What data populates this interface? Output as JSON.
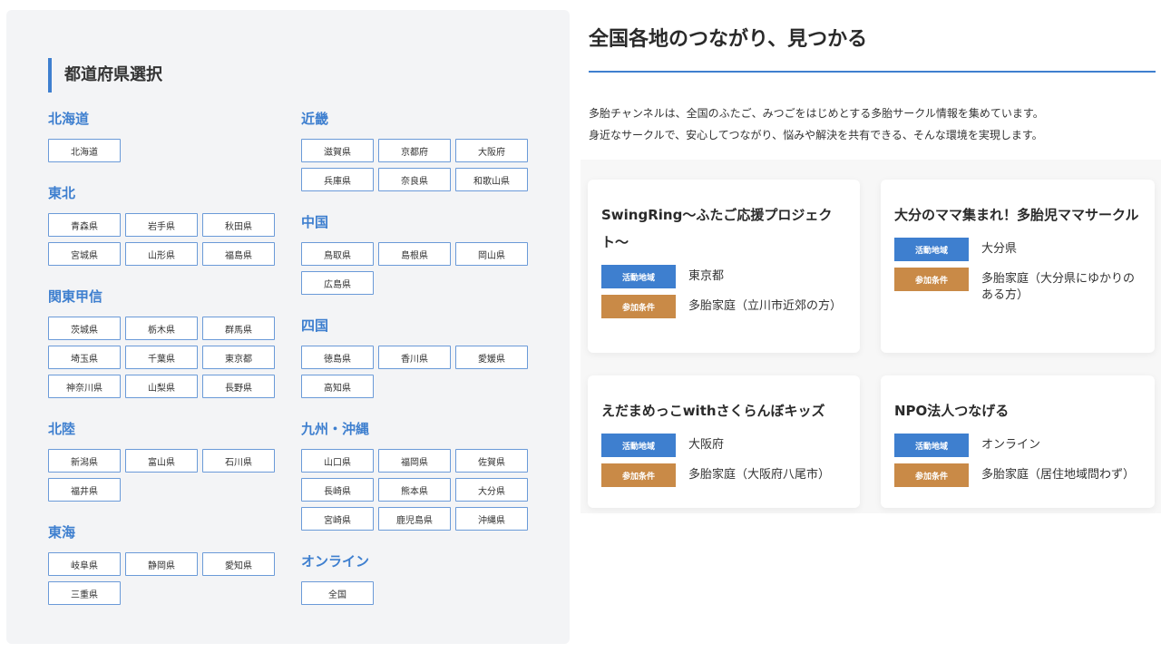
{
  "panel": {
    "title": "都道府県選択",
    "left_regions": [
      {
        "name": "北海道",
        "prefs": [
          "北海道"
        ]
      },
      {
        "name": "東北",
        "prefs": [
          "青森県",
          "岩手県",
          "秋田県",
          "宮城県",
          "山形県",
          "福島県"
        ]
      },
      {
        "name": "関東甲信",
        "prefs": [
          "茨城県",
          "栃木県",
          "群馬県",
          "埼玉県",
          "千葉県",
          "東京都",
          "神奈川県",
          "山梨県",
          "長野県"
        ]
      },
      {
        "name": "北陸",
        "prefs": [
          "新潟県",
          "富山県",
          "石川県",
          "福井県"
        ]
      },
      {
        "name": "東海",
        "prefs": [
          "岐阜県",
          "静岡県",
          "愛知県",
          "三重県"
        ]
      }
    ],
    "right_regions": [
      {
        "name": "近畿",
        "prefs": [
          "滋賀県",
          "京都府",
          "大阪府",
          "兵庫県",
          "奈良県",
          "和歌山県"
        ]
      },
      {
        "name": "中国",
        "prefs": [
          "鳥取県",
          "島根県",
          "岡山県",
          "広島県"
        ]
      },
      {
        "name": "四国",
        "prefs": [
          "徳島県",
          "香川県",
          "愛媛県",
          "高知県"
        ]
      },
      {
        "name": "九州・沖縄",
        "prefs": [
          "山口県",
          "福岡県",
          "佐賀県",
          "長崎県",
          "熊本県",
          "大分県",
          "宮崎県",
          "鹿児島県",
          "沖縄県"
        ]
      },
      {
        "name": "オンライン",
        "prefs": [
          "全国"
        ]
      }
    ]
  },
  "main": {
    "title": "全国各地のつながり、見つかる",
    "desc_line1": "多胎チャンネルは、全国のふたご、みつごをはじめとする多胎サークル情報を集めています。",
    "desc_line2": "身近なサークルで、安心してつながり、悩みや解決を共有できる、そんな環境を実現します。"
  },
  "labels": {
    "area": "活動地域",
    "condition": "参加条件"
  },
  "cards": [
    {
      "title": "SwingRing〜ふたご応援プロジェクト〜",
      "area": "東京都",
      "condition": "多胎家庭（立川市近郊の方）"
    },
    {
      "title": "大分のママ集まれ！多胎児ママサークル",
      "area": "大分県",
      "condition": "多胎家庭（大分県にゆかりのある方）"
    },
    {
      "title": "えだまめっこwithさくらんぼキッズ",
      "area": "大阪府",
      "condition": "多胎家庭（大阪府八尾市）"
    },
    {
      "title": "NPO法人つなげる",
      "area": "オンライン",
      "condition": "多胎家庭（居住地域問わず）"
    }
  ],
  "colors": {
    "accent": "#3e7fcf",
    "condition_badge": "#c98a47",
    "panel_bg": "#f3f4f6"
  }
}
